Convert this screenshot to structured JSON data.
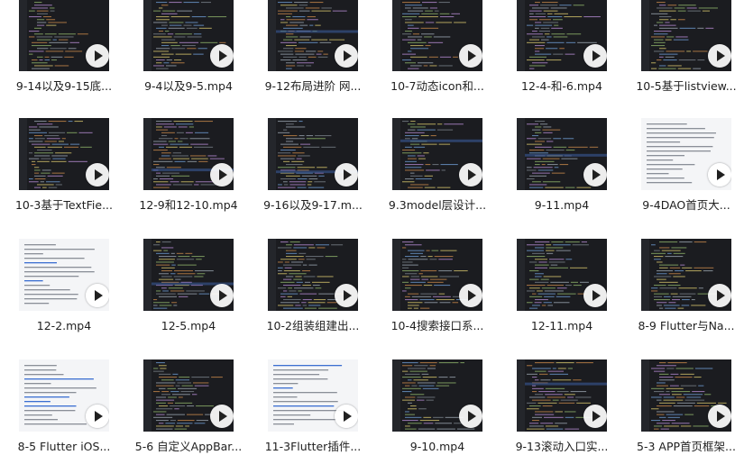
{
  "files": [
    {
      "name": "9-14以及9-15底...",
      "thumb_style": "code"
    },
    {
      "name": "9-4以及9-5.mp4",
      "thumb_style": "code"
    },
    {
      "name": "9-12布局进阶 网...",
      "thumb_style": "code"
    },
    {
      "name": "10-7动态icon和...",
      "thumb_style": "code"
    },
    {
      "name": "12-4-和-6.mp4",
      "thumb_style": "code"
    },
    {
      "name": "10-5基于listview...",
      "thumb_style": "code"
    },
    {
      "name": "10-3基于TextFie...",
      "thumb_style": "code"
    },
    {
      "name": "12-9和12-10.mp4",
      "thumb_style": "code"
    },
    {
      "name": "9-16以及9-17.m...",
      "thumb_style": "code"
    },
    {
      "name": "9.3model层设计...",
      "thumb_style": "code"
    },
    {
      "name": "9-11.mp4",
      "thumb_style": "code"
    },
    {
      "name": "9-4DAO首页大...",
      "thumb_style": "doc"
    },
    {
      "name": "12-2.mp4",
      "thumb_style": "doc"
    },
    {
      "name": "12-5.mp4",
      "thumb_style": "code"
    },
    {
      "name": "10-2组装组建出...",
      "thumb_style": "code"
    },
    {
      "name": "10-4搜索接口系...",
      "thumb_style": "code"
    },
    {
      "name": "12-11.mp4",
      "thumb_style": "code"
    },
    {
      "name": "8-9 Flutter与Na...",
      "thumb_style": "code"
    },
    {
      "name": "8-5 Flutter iOS...",
      "thumb_style": "doc"
    },
    {
      "name": "5-6 自定义AppBar...",
      "thumb_style": "code"
    },
    {
      "name": "11-3Flutter插件...",
      "thumb_style": "doc"
    },
    {
      "name": "9-10.mp4",
      "thumb_style": "code"
    },
    {
      "name": "9-13滚动入口实...",
      "thumb_style": "code"
    },
    {
      "name": "5-3 APP首页框架...",
      "thumb_style": "code"
    }
  ],
  "icons": {
    "play": "play-icon"
  }
}
